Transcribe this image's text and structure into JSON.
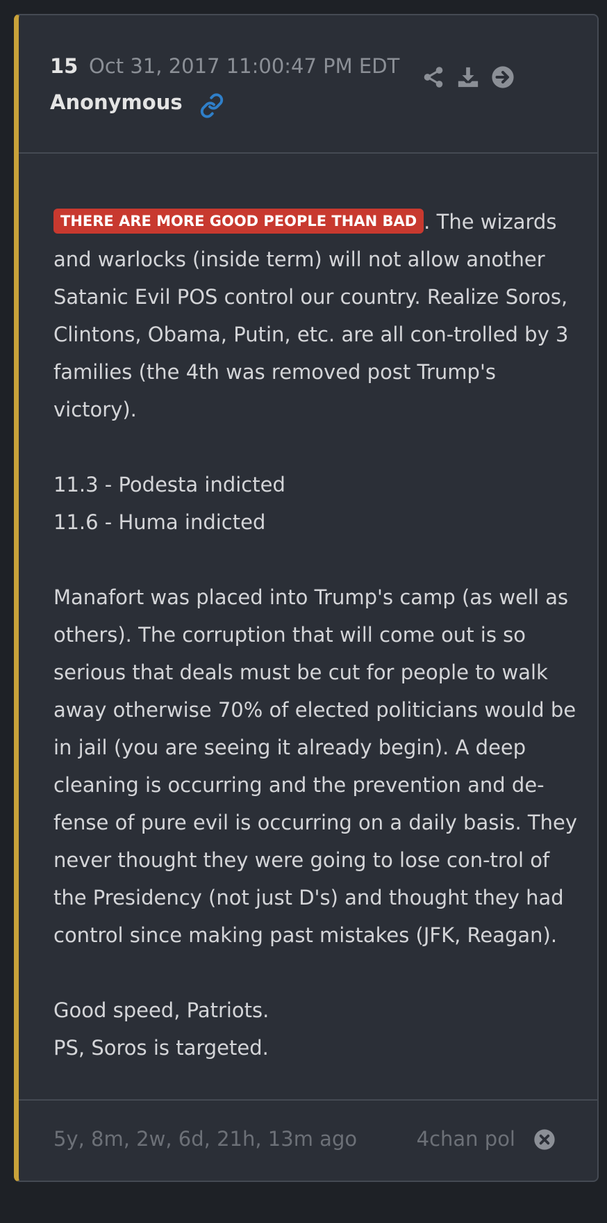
{
  "post": {
    "number": "15",
    "timestamp": "Oct 31, 2017 11:00:47 PM EDT",
    "author": "Anonymous"
  },
  "header_icons": [
    "share-icon",
    "download-icon",
    "arrow-right-circle-icon",
    "link-icon"
  ],
  "body": {
    "tag": "THERE ARE MORE GOOD PEOPLE THAN BAD",
    "p1_rest": ". The wizards and warlocks (inside term) will not allow another Satanic Evil POS control our country. Realize Soros, Clintons, Obama, Putin, etc. are all con-trolled by 3 families (the 4th was removed post Trump's victory).",
    "line_1": "11.3 - Podesta indicted",
    "line_2": "11.6 - Huma indicted",
    "p3": "Manafort was placed into Trump's camp (as well as others). The corruption that will come out is so serious that deals must be cut for people to walk away otherwise 70% of elected politicians would be in jail (you are seeing it already begin). A deep cleaning is occurring and the prevention and de-fense of pure evil is occurring on a daily basis. They never thought they were going to lose con-trol of the Presidency (not just D's) and thought they had control since making past mistakes (JFK, Reagan).",
    "line_3": "Good speed, Patriots.",
    "line_4": "PS, Soros is targeted."
  },
  "footer": {
    "ago": "5y, 8m, 2w, 6d, 21h, 13m ago",
    "source": "4chan pol"
  },
  "colors": {
    "accent_bar": "#c9a23a",
    "tag_bg": "#c8392f",
    "link_icon": "#2f7fc9",
    "card_bg": "#2b2f37"
  }
}
